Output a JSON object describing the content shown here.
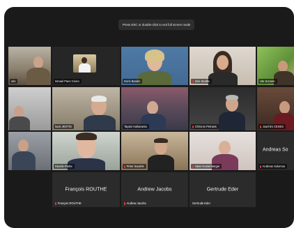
{
  "toast": "Press ESC or double-click to exit full screen mode",
  "participants": [
    {
      "name": "otis",
      "mic_muted": false
    },
    {
      "name": "Ismael Paez Civico",
      "mic_muted": false
    },
    {
      "name": "Doris Bandin",
      "mic_muted": false
    },
    {
      "name": "Inés Sevilla",
      "mic_muted": true
    },
    {
      "name": "Ute Sonnen",
      "mic_muted": false
    },
    {
      "name": "louis JESTIN",
      "mic_muted": false
    },
    {
      "name": "Tapani Kaikaranta",
      "mic_muted": false
    },
    {
      "name": "Chrisros Petrasis",
      "mic_muted": true
    },
    {
      "name": "Joachim CESES",
      "mic_muted": true
    },
    {
      "name": "Davide Prette",
      "mic_muted": false
    },
    {
      "name": "Peter Saurink",
      "mic_muted": true
    },
    {
      "name": "Hans Humenberger",
      "mic_muted": true
    },
    {
      "name": "Andreas Solomou",
      "mic_muted": true,
      "display_name": "Andreas So"
    },
    {
      "name": "François ROUTHE",
      "mic_muted": true,
      "display_name": "François ROUTHE"
    },
    {
      "name": "Andrew Jacobs",
      "mic_muted": true,
      "display_name": "Andrew Jacobs"
    },
    {
      "name": "Gertrude Eder",
      "mic_muted": false,
      "display_name": "Gertrude Eder"
    }
  ],
  "colors": {
    "active_speaker": "#5fd35f",
    "muted_mic": "#e0383e",
    "window_bg": "#1a1a1a"
  }
}
